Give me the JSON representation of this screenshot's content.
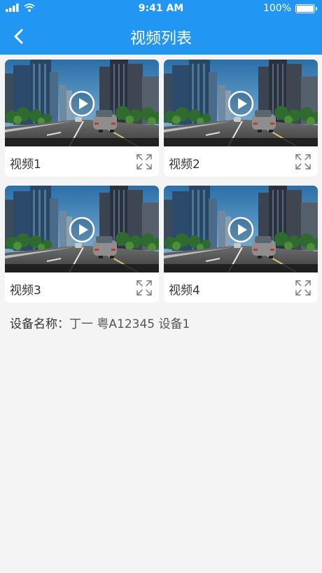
{
  "status_bar": {
    "time": "9:41 AM",
    "battery": "100%"
  },
  "navbar": {
    "title": "视频列表",
    "back_icon": "chevron-left-icon"
  },
  "videos": [
    {
      "label": "视频1",
      "play_icon": "play-circle-icon",
      "expand_icon": "fullscreen-icon"
    },
    {
      "label": "视频2",
      "play_icon": "play-circle-icon",
      "expand_icon": "fullscreen-icon"
    },
    {
      "label": "视频3",
      "play_icon": "play-circle-icon",
      "expand_icon": "fullscreen-icon"
    },
    {
      "label": "视频4",
      "play_icon": "play-circle-icon",
      "expand_icon": "fullscreen-icon"
    }
  ],
  "device": {
    "label": "设备名称：",
    "value": "丁一 粤A12345 设备1"
  },
  "colors": {
    "primary": "#2196f3",
    "background": "#f4f4f5",
    "card": "#ffffff"
  }
}
